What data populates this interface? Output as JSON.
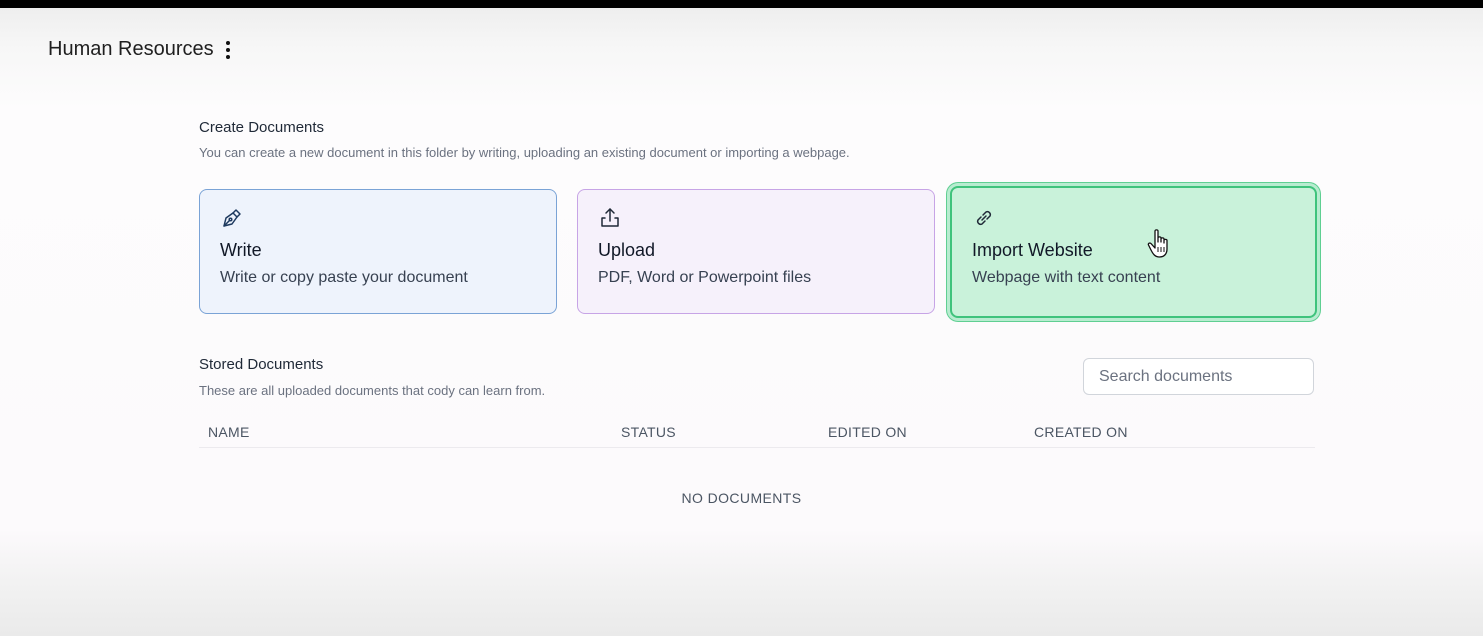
{
  "header": {
    "title": "Human Resources",
    "menu_icon": "kebab-menu-icon"
  },
  "create": {
    "title": "Create Documents",
    "subtitle": "You can create a new document in this folder by writing, uploading an existing document or importing a webpage.",
    "cards": [
      {
        "icon": "pen-icon",
        "title": "Write",
        "description": "Write or copy paste your document",
        "accent": "#7aa3d6"
      },
      {
        "icon": "upload-icon",
        "title": "Upload",
        "description": "PDF, Word or Powerpoint files",
        "accent": "#c7a4e6"
      },
      {
        "icon": "link-icon",
        "title": "Import Website",
        "description": "Webpage with text content",
        "accent": "#3fc37c"
      }
    ]
  },
  "stored": {
    "title": "Stored Documents",
    "subtitle": "These are all uploaded documents that cody can learn from.",
    "search_placeholder": "Search documents",
    "columns": [
      "NAME",
      "STATUS",
      "EDITED ON",
      "CREATED ON"
    ],
    "empty_text": "NO DOCUMENTS"
  }
}
